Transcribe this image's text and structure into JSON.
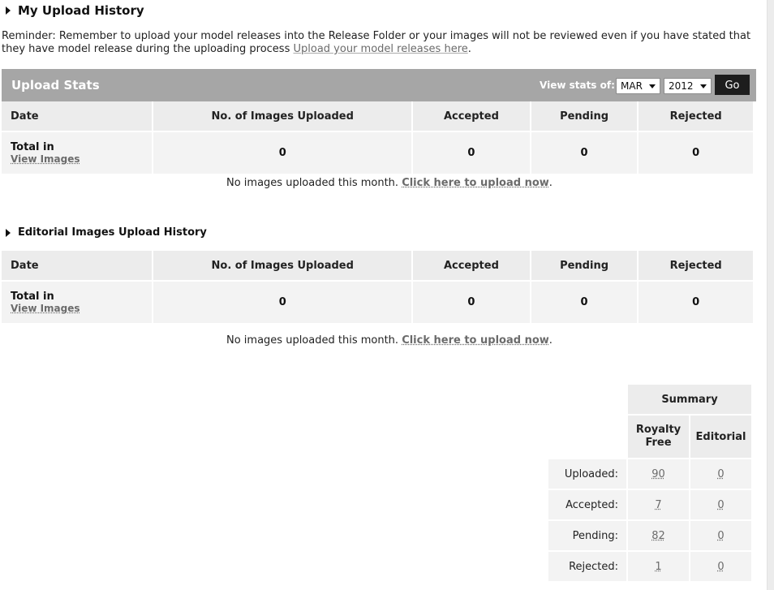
{
  "page": {
    "title": "My Upload History",
    "reminder_text": "Reminder: Remember to upload your model releases into the Release Folder or your images will not be reviewed even if you have stated that they have model release during the uploading process",
    "reminder_link": "Upload your model releases here",
    "reminder_end": "."
  },
  "stats": {
    "title": "Upload Stats",
    "view_label": "View stats of:",
    "month": "MAR",
    "year": "2012",
    "go_label": "Go"
  },
  "columns": {
    "date": "Date",
    "uploaded": "No. of Images Uploaded",
    "accepted": "Accepted",
    "pending": "Pending",
    "rejected": "Rejected"
  },
  "upload_table": {
    "total_label": "Total in",
    "view_images": "View Images",
    "uploaded": "0",
    "accepted": "0",
    "pending": "0",
    "rejected": "0",
    "empty_text": "No images uploaded this month.",
    "empty_link": "Click here to upload now",
    "empty_end": "."
  },
  "editorial": {
    "title": "Editorial Images Upload History",
    "total_label": "Total in",
    "view_images": "View Images",
    "uploaded": "0",
    "accepted": "0",
    "pending": "0",
    "rejected": "0",
    "empty_text": "No images uploaded this month.",
    "empty_link": "Click here to upload now",
    "empty_end": "."
  },
  "summary": {
    "title": "Summary",
    "col_rf": "Royalty Free",
    "col_ed": "Editorial",
    "rows": [
      {
        "label": "Uploaded:",
        "rf": "90",
        "ed": "0"
      },
      {
        "label": "Accepted:",
        "rf": "7",
        "ed": "0"
      },
      {
        "label": "Pending:",
        "rf": "82",
        "ed": "0"
      },
      {
        "label": "Rejected:",
        "rf": "1",
        "ed": "0"
      }
    ]
  }
}
